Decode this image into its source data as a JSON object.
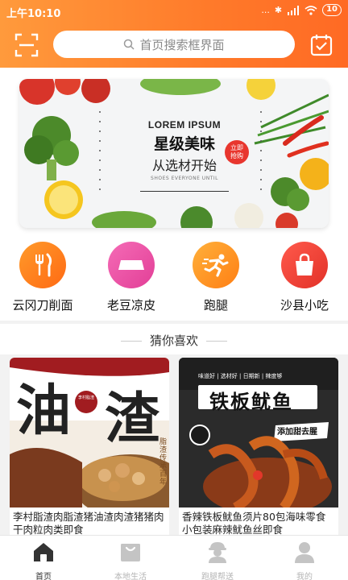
{
  "status_bar": {
    "time": "上午10:10",
    "network": "...",
    "battery": "10"
  },
  "header": {
    "search_placeholder": "首页搜索框界面"
  },
  "banner": {
    "en_title": "LOREM IPSUM",
    "title": "星级美味",
    "subtitle": "从选材开始",
    "small": "SHOES EVERYONE UNTIL",
    "badge_line1": "立即",
    "badge_line2": "抢购"
  },
  "categories": [
    {
      "label": "云冈刀削面",
      "icon": "fork-knife-icon",
      "color": "#ff7a1a"
    },
    {
      "label": "老豆凉皮",
      "icon": "tray-icon",
      "color": "#e94fa6"
    },
    {
      "label": "跑腿",
      "icon": "runner-icon",
      "color": "#ff8c1a"
    },
    {
      "label": "沙县小吃",
      "icon": "shopping-bag-icon",
      "color": "#ef4238"
    }
  ],
  "section": {
    "title": "猜你喜欢"
  },
  "products": [
    {
      "title": "李村脂渣肉脂渣猪油渣肉渣猪猪肉干肉粒肉类即食",
      "img_text_1": "油",
      "img_text_2": "渣",
      "img_side": "脂渣传承百年",
      "img_logo": "李村脂渣"
    },
    {
      "title": "香辣铁板鱿鱼须片80包海味零食小包装麻辣鱿鱼丝即食",
      "img_text_1": "铁板鱿鱼",
      "img_tags": "味道好 | 选材好 | 日期新 | 辣度够",
      "img_sticker": "添加甜去腥"
    }
  ],
  "tabbar": [
    {
      "label": "首页",
      "icon": "home-icon",
      "active": true
    },
    {
      "label": "本地生活",
      "icon": "shopping-bag-icon",
      "active": false
    },
    {
      "label": "跑腿帮送",
      "icon": "courier-icon",
      "active": false
    },
    {
      "label": "我的",
      "icon": "user-icon",
      "active": false
    }
  ],
  "colors": {
    "header_start": "#ff9a3c",
    "header_end": "#ff6a24",
    "accent": "#ff7a1a"
  }
}
